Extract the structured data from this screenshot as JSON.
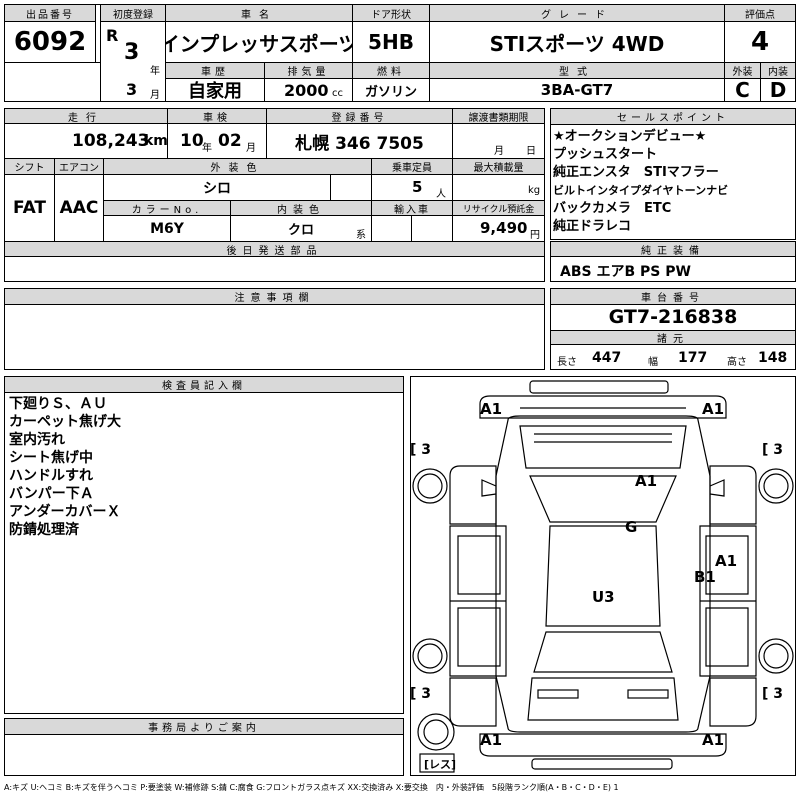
{
  "header": {
    "lot_no_label": "出品番号",
    "lot_no": "6092",
    "first_reg_label": "初度登録",
    "era": "R",
    "year": "3",
    "year_unit": "年",
    "month": "3",
    "month_unit": "月",
    "car_name_label": "車名",
    "car_name": "インプレッサスポーツ",
    "door_label": "ドア形状",
    "door": "5HB",
    "grade_label": "グレード",
    "grade": "STIスポーツ 4WD",
    "score_label": "評価点",
    "score": "4",
    "history_label": "車歴",
    "history": "自家用",
    "displacement_label": "排気量",
    "displacement": "2000",
    "displacement_unit": "cc",
    "fuel_label": "燃料",
    "fuel": "ガソリン",
    "model_label": "型式",
    "model": "3BA-GT7",
    "exterior_label": "外装",
    "exterior": "C",
    "interior_label": "内装",
    "interior": "D"
  },
  "row2": {
    "mileage_label": "走行",
    "mileage": "108,243",
    "mileage_unit": "km",
    "inspection_label": "車検",
    "inspection_year": "10",
    "inspection_month": "02",
    "year_unit": "年",
    "month_unit": "月",
    "plate_label": "登録番号",
    "plate": "札幌 346 7505",
    "transfer_label": "譲渡書類期限",
    "transfer_month_unit": "月",
    "transfer_day_unit": "日"
  },
  "row3": {
    "shift_label": "シフト",
    "shift": "FAT",
    "ac_label": "エアコン",
    "ac": "AAC",
    "color_label": "外装色",
    "color": "シロ",
    "capacity_label": "乗車定員",
    "capacity": "5",
    "capacity_unit": "人",
    "load_label": "最大積載量",
    "load_unit": "kg",
    "color_no_label": "カラーNo.",
    "color_no": "M6Y",
    "int_color_label": "内装色",
    "int_color": "クロ",
    "int_color_unit": "系",
    "import_label": "輸入車",
    "recycle_label": "リサイクル預託金",
    "recycle": "9,490",
    "recycle_unit": "円"
  },
  "sales_points": {
    "label": "セールスポイント",
    "items": [
      "★オークションデビュー★",
      "プッシュスタート",
      "純正エンスタ　STIマフラー",
      "ビルトインタイプダイヤトーンナビ",
      "バックカメラ　ETC",
      "純正ドラレコ"
    ]
  },
  "later_parts_label": "後日発送部品",
  "genuine": {
    "label": "純正装備",
    "value": "ABS エアB PS PW"
  },
  "notes_label": "注意事項欄",
  "chassis": {
    "label": "車台番号",
    "value": "GT7-216838"
  },
  "dims": {
    "label": "諸元",
    "length_label": "長さ",
    "length": "447",
    "width_label": "幅",
    "width": "177",
    "height_label": "高さ",
    "height": "148"
  },
  "inspector": {
    "label": "検査員記入欄",
    "lines": [
      "下廻りＳ、ＡＵ",
      "カーペット焦げ大",
      "室内汚れ",
      "シート焦げ中",
      "ハンドルすれ",
      "バンパー下Ａ",
      "アンダーカバーＸ",
      "防錆処理済"
    ]
  },
  "office_label": "事務局よりご案内",
  "diagram": {
    "front_left": "A1",
    "front_right": "A1",
    "rear_left": "A1",
    "rear_right": "A1",
    "hood": "A1",
    "windshield": "G",
    "right_side_1": "A1",
    "right_side_2": "B1",
    "roof": "U3",
    "tire": "3",
    "spare_label": "レス"
  },
  "legend": "A:キズ U:ヘコミ B:キズを伴うヘコミ P:要塗装 W:補修跡 S:錆 C:腐食 G:フロントガラス点キズ XX:交換済み X:要交換　内・外装評価　5段階ランク順(A・B・C・D・E) 1"
}
